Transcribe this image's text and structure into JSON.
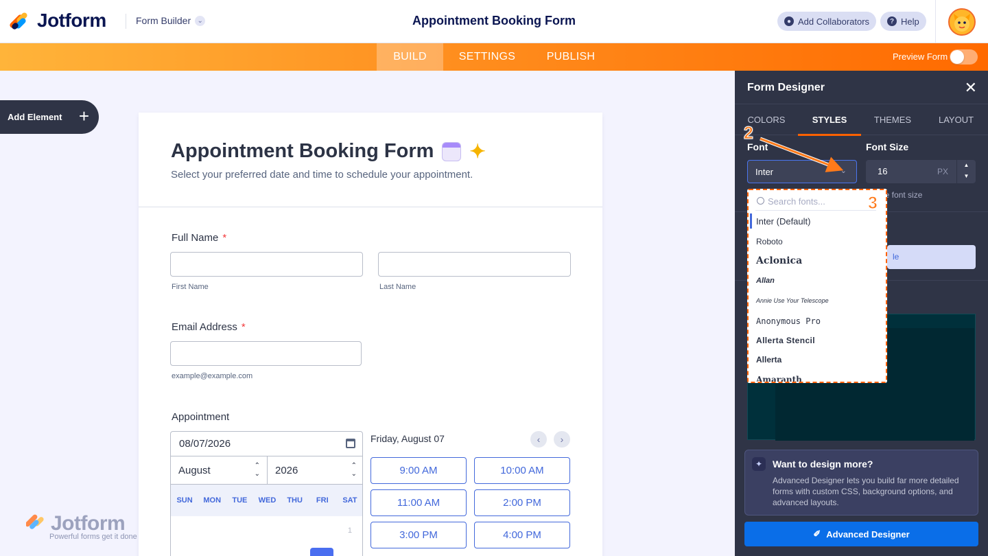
{
  "header": {
    "brand": "Jotform",
    "builder_select": "Form Builder",
    "title": "Appointment Booking Form",
    "collab_label": "Add Collaborators",
    "help_label": "Help"
  },
  "nav": {
    "tabs": [
      "BUILD",
      "SETTINGS",
      "PUBLISH"
    ],
    "active": "BUILD",
    "preview_label": "Preview Form"
  },
  "sidebar": {
    "add_element": "Add Element"
  },
  "form": {
    "title": "Appointment Booking Form",
    "subtitle": "Select your preferred date and time to schedule your appointment.",
    "full_name_label": "Full Name",
    "required_mark": "*",
    "first_name_sub": "First Name",
    "last_name_sub": "Last Name",
    "email_label": "Email Address",
    "email_sub": "example@example.com",
    "appointment_label": "Appointment",
    "date_value": "08/07/2026",
    "month_value": "August",
    "year_value": "2026",
    "weekdays": [
      "SUN",
      "MON",
      "TUE",
      "WED",
      "THU",
      "FRI",
      "SAT"
    ],
    "first_day": "1",
    "selected_date_title": "Friday, August 07",
    "slots": [
      "9:00 AM",
      "10:00 AM",
      "11:00 AM",
      "2:00 PM",
      "3:00 PM",
      "4:00 PM"
    ]
  },
  "watermark": {
    "brand": "Jotform",
    "tagline": "Powerful forms get it done"
  },
  "panel": {
    "title": "Form Designer",
    "tabs": [
      "COLORS",
      "STYLES",
      "THEMES",
      "LAYOUT"
    ],
    "active_tab": "STYLES",
    "font_label": "Font",
    "font_value": "Inter",
    "font_size_label": "Font Size",
    "font_size_value": "16",
    "font_size_unit": "PX",
    "font_size_hint": "ge font size",
    "partial_button": "le",
    "promo_title": "Want to design more?",
    "promo_text": "Advanced Designer lets you build far more detailed forms with custom CSS, background options, and advanced layouts.",
    "advanced_button": "Advanced Designer"
  },
  "font_dropdown": {
    "search_placeholder": "Search fonts...",
    "fonts": [
      "Inter (Default)",
      "Roboto",
      "Aclonica",
      "Allan",
      "Annie Use Your Telescope",
      "Anonymous Pro",
      "Allerta Stencil",
      "Allerta",
      "Amaranth"
    ]
  },
  "annotations": {
    "step_2": "2",
    "step_3": "3"
  },
  "colors": {
    "accent_orange": "#ff6100",
    "brand_navy": "#0a1551",
    "panel_bg": "#2f3446",
    "slot_blue": "#4268db"
  }
}
